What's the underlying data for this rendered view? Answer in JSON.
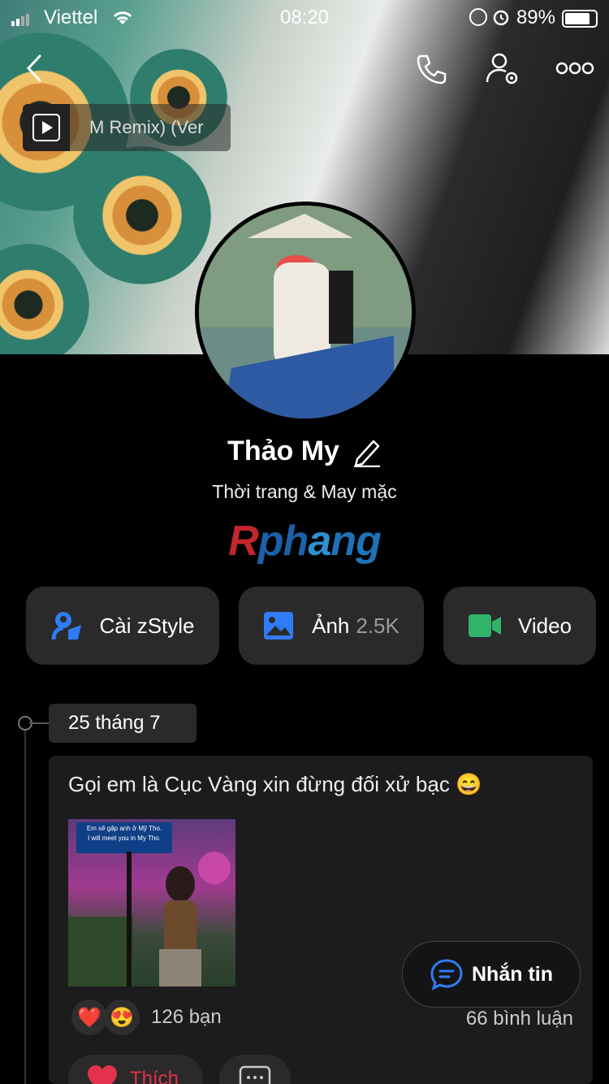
{
  "status_bar": {
    "carrier": "Viettel",
    "time": "08:20",
    "battery": "89%"
  },
  "header": {
    "music_title": "M Remix) (Ver"
  },
  "profile": {
    "name": "Thảo My",
    "category": "Thời trang & May mặc",
    "watermark": "Rphang"
  },
  "actions": {
    "zstyle": "Cài zStyle",
    "photos_label": "Ảnh",
    "photos_count": "2.5K",
    "video": "Video"
  },
  "timeline": {
    "date": "25 tháng 7"
  },
  "post": {
    "caption": "Gọi em là Cục Vàng xin đừng đối xử bạc 😄",
    "photo_sign_line1": "Em sẽ gặp anh ở Mỹ Tho.",
    "photo_sign_line2": "I will meet you in My Tho.",
    "reaction_1": "❤️",
    "reaction_2": "😍",
    "reaction_count": "126 bạn",
    "comments": "66 bình luận",
    "like_label": "Thích"
  },
  "floating": {
    "message_label": "Nhắn tin"
  },
  "colors": {
    "accent_blue": "#2f7cf6",
    "video_green": "#2fb46a",
    "like_red": "#e3324b"
  }
}
